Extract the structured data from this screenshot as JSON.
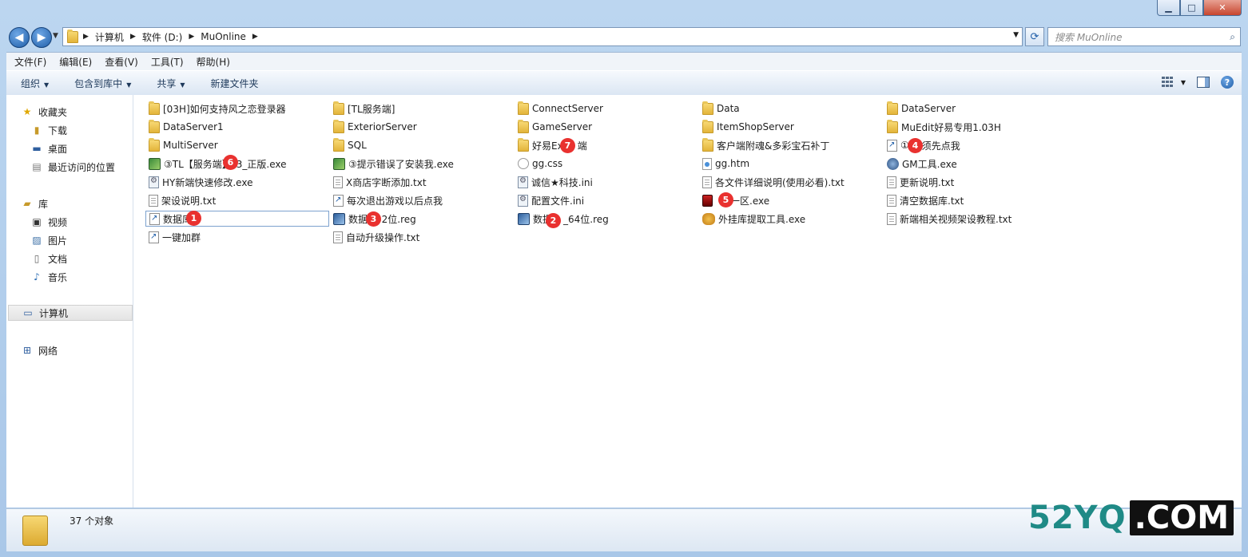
{
  "window": {
    "minimize": "▁",
    "maximize": "□",
    "close": "✕"
  },
  "nav": {
    "back": "◀",
    "forward": "▶"
  },
  "address": {
    "segments": [
      "计算机",
      "软件 (D:)",
      "MuOnline"
    ]
  },
  "search": {
    "placeholder": "搜索 MuOnline"
  },
  "menu": [
    "文件(F)",
    "编辑(E)",
    "查看(V)",
    "工具(T)",
    "帮助(H)"
  ],
  "toolbar": {
    "organize": "组织",
    "include_library": "包含到库中",
    "share": "共享",
    "new_folder": "新建文件夹"
  },
  "sidebar": {
    "favorites": "收藏夹",
    "downloads": "下载",
    "desktop": "桌面",
    "recent": "最近访问的位置",
    "libraries": "库",
    "videos": "视频",
    "pictures": "图片",
    "documents": "文档",
    "music": "音乐",
    "computer": "计算机",
    "network": "网络"
  },
  "files": [
    {
      "name": "[03H]如何支持风之恋登录器",
      "type": "folder"
    },
    {
      "name": "[TL服务端]",
      "type": "folder"
    },
    {
      "name": "ConnectServer",
      "type": "folder"
    },
    {
      "name": "Data",
      "type": "folder"
    },
    {
      "name": "DataServer",
      "type": "folder"
    },
    {
      "name": "DataServer1",
      "type": "folder"
    },
    {
      "name": "ExteriorServer",
      "type": "folder"
    },
    {
      "name": "GameServer",
      "type": "folder"
    },
    {
      "name": "ItemShopServer",
      "type": "folder"
    },
    {
      "name": "MuEdit好易专用1.03H",
      "type": "folder"
    },
    {
      "name": "MultiServer",
      "type": "folder"
    },
    {
      "name": "SQL",
      "type": "folder"
    },
    {
      "name": "好易Ex",
      "type": "folder",
      "name_tail": "端"
    },
    {
      "name": "客户端附魂&多彩宝石补丁",
      "type": "folder"
    },
    {
      "name": "①",
      "type": "link",
      "name_tail": "须先点我"
    },
    {
      "name": "③TL【服务端】",
      "type": "exe",
      "name_tail": "3_正版.exe"
    },
    {
      "name": "③提示错误了安装我.exe",
      "type": "exe"
    },
    {
      "name": "gg.css",
      "type": "css"
    },
    {
      "name": "gg.htm",
      "type": "htm"
    },
    {
      "name": "GM工具.exe",
      "type": "gm"
    },
    {
      "name": "HY新端快速修改.exe",
      "type": "exe"
    },
    {
      "name": "X商店字断添加.txt",
      "type": "doc"
    },
    {
      "name": "诚信★科技.ini",
      "type": "ini"
    },
    {
      "name": "各文件详细说明(使用必看).txt",
      "type": "doc"
    },
    {
      "name": "更新说明.txt",
      "type": "doc"
    },
    {
      "name": "架设说明.txt",
      "type": "doc"
    },
    {
      "name": "每次退出游戏以后点我",
      "type": "link"
    },
    {
      "name": "配置文件.ini",
      "type": "ini"
    },
    {
      "name": "",
      "type": "red",
      "name_tail": "一区.exe"
    },
    {
      "name": "清空数据库.txt",
      "type": "doc"
    },
    {
      "name": "数据库",
      "type": "link"
    },
    {
      "name": "数据",
      "type": "reg",
      "name_tail": "32位.reg"
    },
    {
      "name": "数据",
      "type": "reg",
      "name_tail": "_64位.reg"
    },
    {
      "name": "外挂库提取工具.exe",
      "type": "cat"
    },
    {
      "name": "新端相关视频架设教程.txt",
      "type": "doc"
    },
    {
      "name": "一键加群",
      "type": "link"
    },
    {
      "name": "自动升级操作.txt",
      "type": "doc"
    }
  ],
  "badges": [
    "1",
    "2",
    "3",
    "4",
    "5",
    "6",
    "7"
  ],
  "status": {
    "count": "37 个对象"
  },
  "watermark": {
    "left": "52YQ",
    "right": ".COM"
  }
}
